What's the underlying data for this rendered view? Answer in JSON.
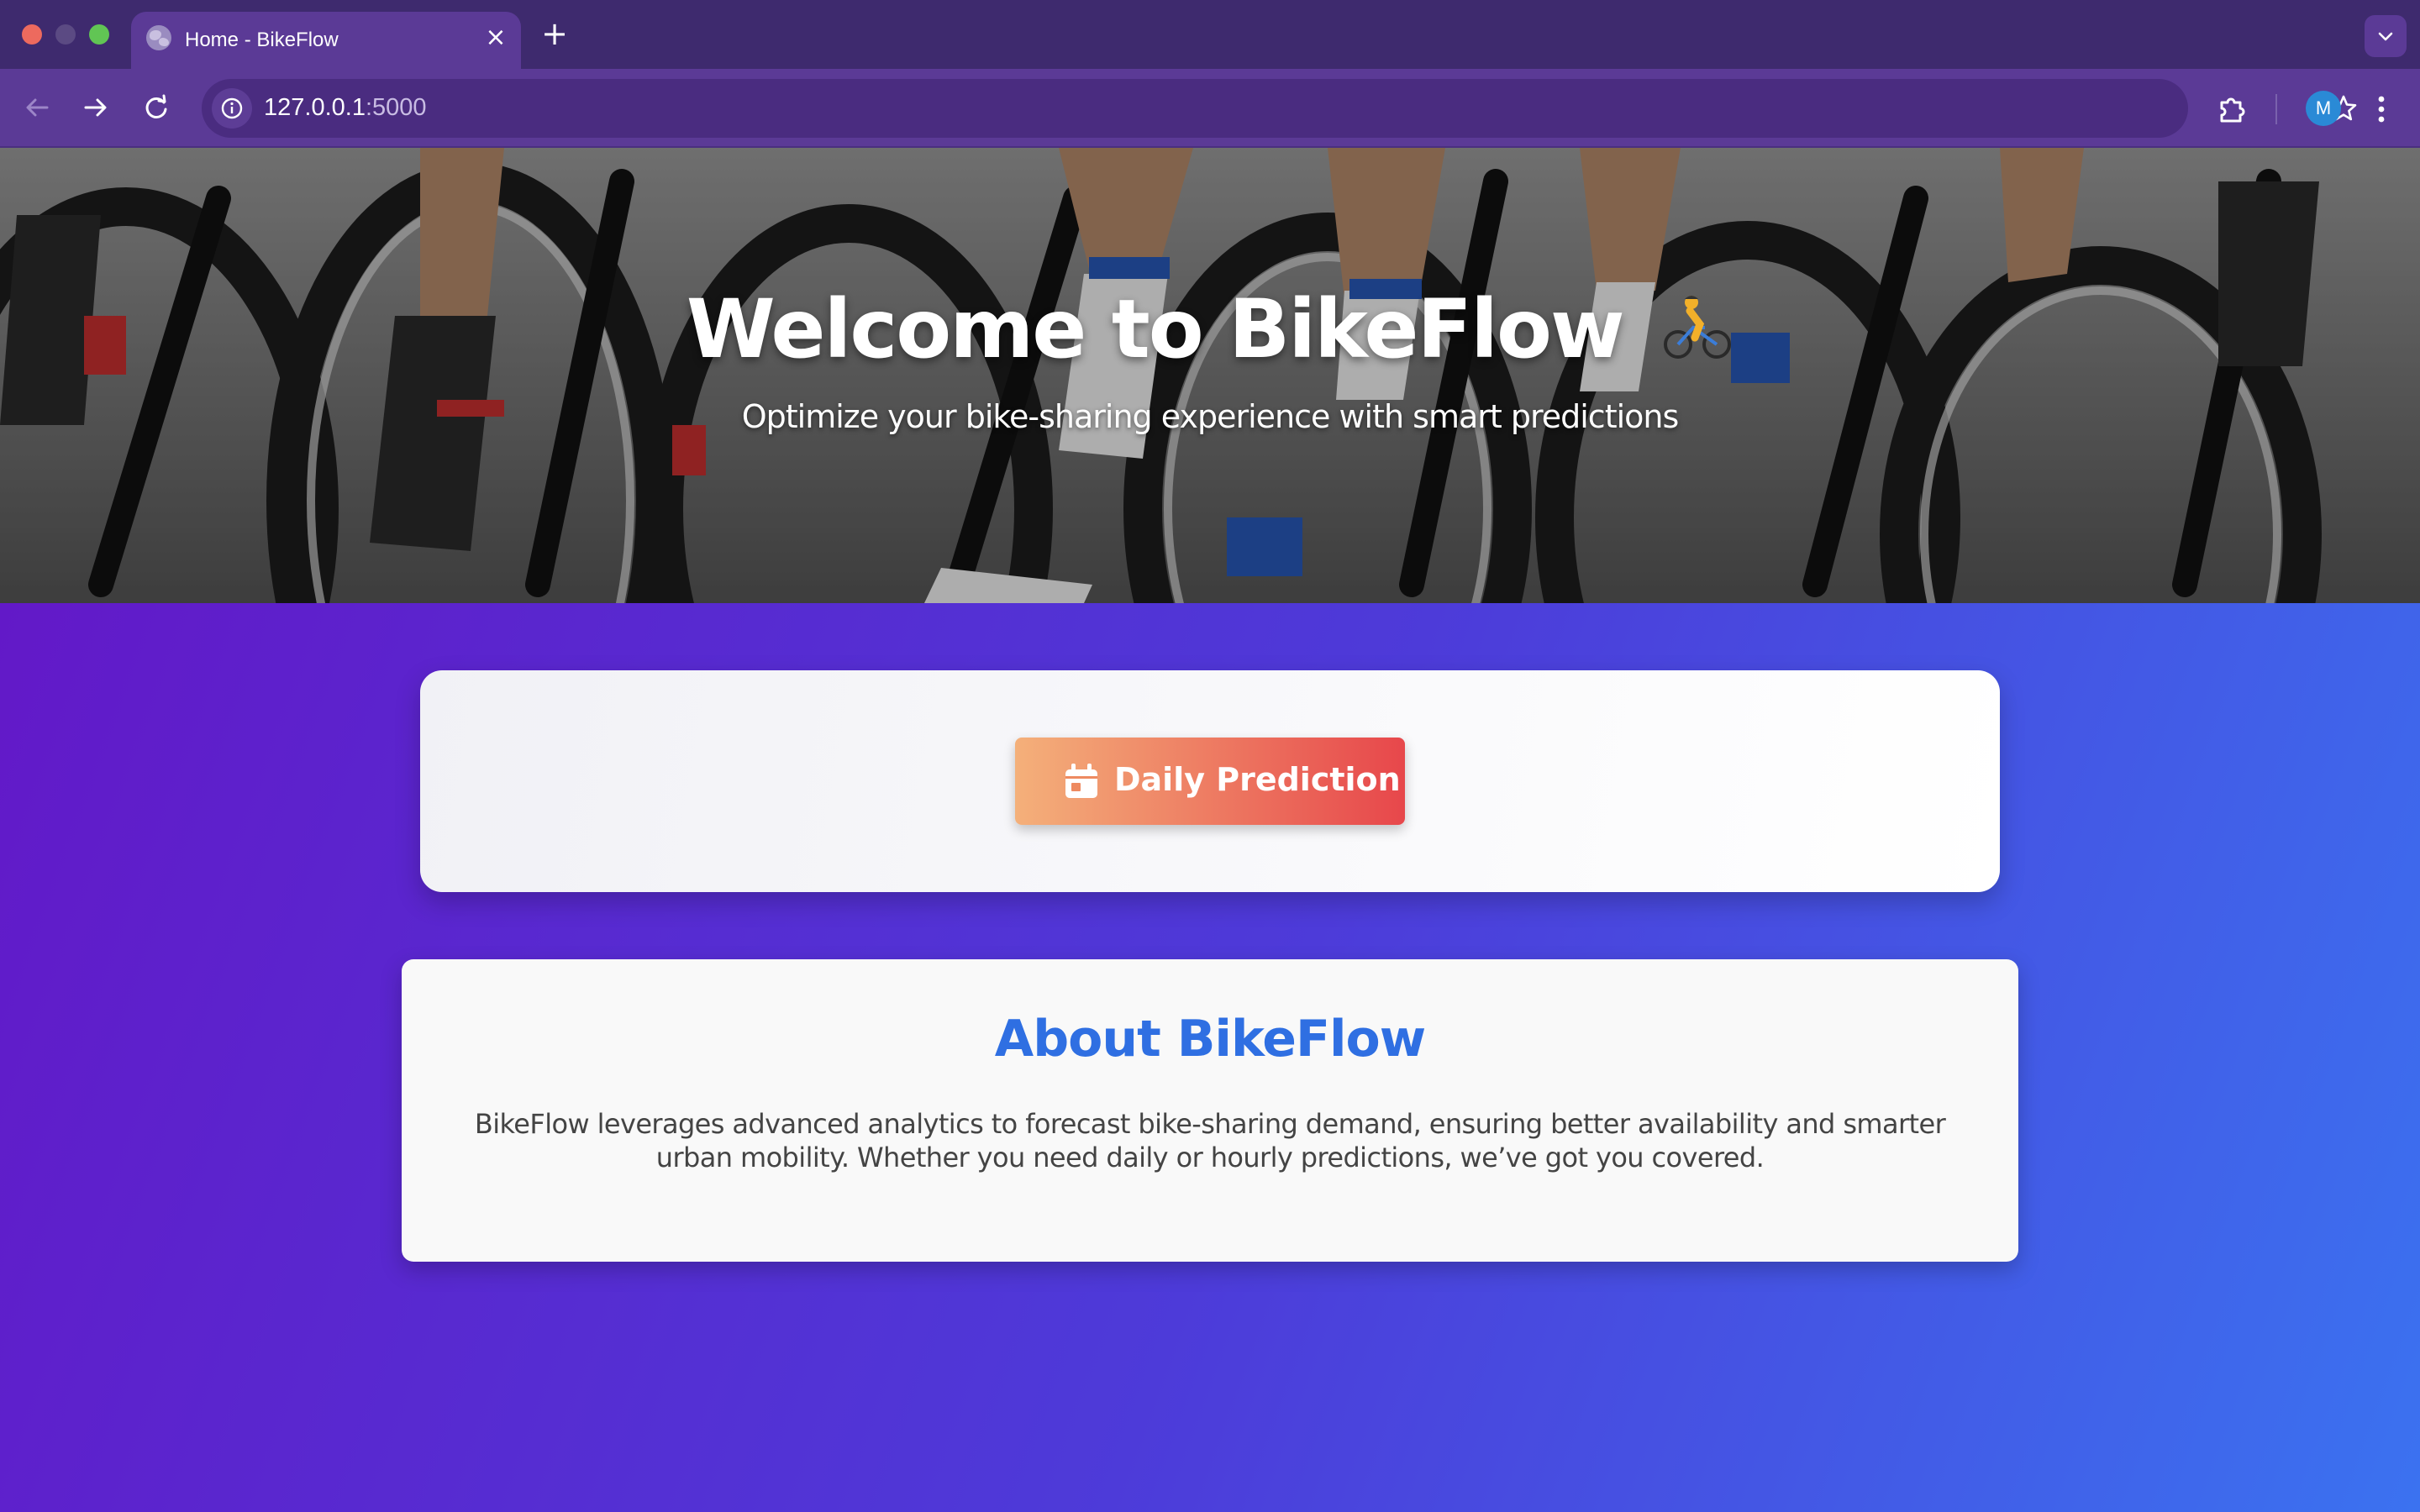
{
  "browser": {
    "tab_title": "Home - BikeFlow",
    "tab_close": "×",
    "new_tab": "+",
    "url_host": "127.0.0.1",
    "url_port": ":5000",
    "profile_initial": "M"
  },
  "hero": {
    "title": "Welcome to BikeFlow",
    "title_emoji": "cyclist-emoji",
    "subtitle": "Optimize your bike-sharing experience with smart predictions"
  },
  "actions": {
    "daily_prediction_label": "Daily Prediction",
    "daily_prediction_icon": "calendar-icon",
    "button_gradient": [
      "#f4b07a",
      "#e7474b"
    ]
  },
  "about": {
    "title": "About BikeFlow",
    "text": "BikeFlow leverages advanced analytics to forecast bike-sharing demand, ensuring better availability and smarter urban mobility. Whether you need daily or hourly predictions, we’ve got you covered."
  },
  "colors": {
    "accent": "#2f6fe2",
    "page_gradient": [
      "#6515c6",
      "#3b72f0"
    ],
    "browser_frame": "#5b3a96"
  }
}
